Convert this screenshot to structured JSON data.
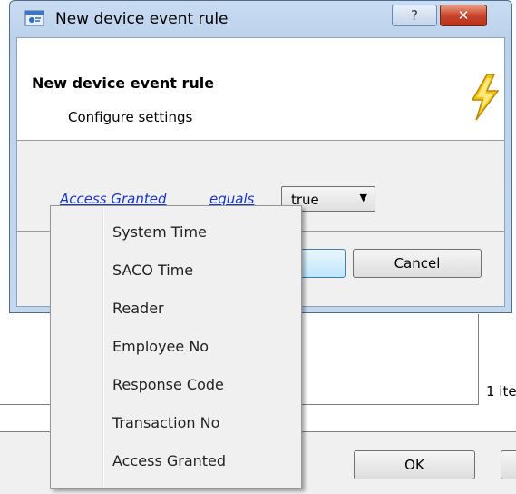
{
  "dialog": {
    "title": "New device event rule",
    "help_label": "?",
    "close_label": "✕",
    "header_title": "New device event rule",
    "header_subtitle": "Configure settings"
  },
  "rule": {
    "field_link": "Access Granted",
    "operator_link": "equals",
    "value": "true"
  },
  "buttons": {
    "cancel": "Cancel",
    "ok": "OK"
  },
  "menu": {
    "items": [
      {
        "label": "System Time"
      },
      {
        "label": "SACO Time"
      },
      {
        "label": "Reader"
      },
      {
        "label": "Employee No"
      },
      {
        "label": "Response Code"
      },
      {
        "label": "Transaction No"
      },
      {
        "label": "Access Granted"
      }
    ]
  },
  "background": {
    "item_count": "1 ite"
  },
  "icons": {
    "window": "device-window-icon",
    "header": "lightning-icon",
    "dropdown": "dropdown-arrow-icon"
  },
  "colors": {
    "link": "#1a36c9",
    "close": "#c8452c",
    "lightning": "#f6c316"
  }
}
